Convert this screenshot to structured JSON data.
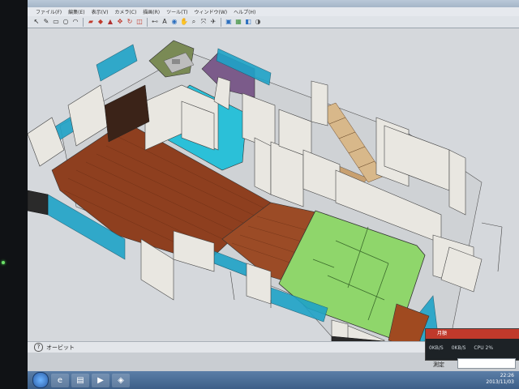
{
  "menu": {
    "items": [
      "ファイル(F)",
      "編集(E)",
      "表示(V)",
      "カメラ(C)",
      "描画(R)",
      "ツール(T)",
      "ウィンドウ(W)",
      "ヘルプ(H)"
    ]
  },
  "toolbar": {
    "tools": [
      {
        "icon": "select-arrow-icon",
        "glyph": "↖",
        "color": "#222"
      },
      {
        "icon": "line-pencil-icon",
        "glyph": "✎",
        "color": "#333"
      },
      {
        "icon": "rectangle-icon",
        "glyph": "▭",
        "color": "#333"
      },
      {
        "icon": "circle-icon",
        "glyph": "○",
        "color": "#333"
      },
      {
        "icon": "arc-icon",
        "glyph": "◠",
        "color": "#333"
      },
      {
        "icon": "eraser-icon",
        "glyph": "▰",
        "color": "#c0392b"
      },
      {
        "icon": "paint-bucket-icon",
        "glyph": "◆",
        "color": "#c0392b"
      },
      {
        "icon": "push-pull-icon",
        "glyph": "▲",
        "color": "#b03030"
      },
      {
        "icon": "move-icon",
        "glyph": "✥",
        "color": "#c0392b"
      },
      {
        "icon": "rotate-icon",
        "glyph": "↻",
        "color": "#c0392b"
      },
      {
        "icon": "offset-icon",
        "glyph": "◫",
        "color": "#c0392b"
      },
      {
        "icon": "tape-measure-icon",
        "glyph": "⊷",
        "color": "#555"
      },
      {
        "icon": "text-icon",
        "glyph": "A",
        "color": "#333"
      },
      {
        "icon": "orbit-icon",
        "glyph": "◉",
        "color": "#2c6fbf"
      },
      {
        "icon": "pan-icon",
        "glyph": "✋",
        "color": "#555"
      },
      {
        "icon": "zoom-icon",
        "glyph": "⌕",
        "color": "#333"
      },
      {
        "icon": "zoom-extents-icon",
        "glyph": "⤧",
        "color": "#333"
      },
      {
        "icon": "walk-icon",
        "glyph": "✈",
        "color": "#333"
      },
      {
        "icon": "component-icon",
        "glyph": "▣",
        "color": "#2c6fbf"
      },
      {
        "icon": "group-icon",
        "glyph": "▦",
        "color": "#3a8f3a"
      },
      {
        "icon": "section-icon",
        "glyph": "◧",
        "color": "#2c6fbf"
      },
      {
        "icon": "shadow-icon",
        "glyph": "◑",
        "color": "#555"
      }
    ]
  },
  "status": {
    "hint": "オービット"
  },
  "measure": {
    "label": "測定"
  },
  "netwidget": {
    "title": "月額",
    "down": "0KB/S",
    "up": "0KB/S",
    "cpu": "CPU 2%"
  },
  "clock": {
    "time": "22:26",
    "date": "2013/11/03"
  },
  "colors": {
    "accent": "#2c6fbf",
    "wall": "#e9e7e1",
    "glass": "#1fa3c7",
    "tatami": "#8fd66b",
    "wood": "#9b4b26"
  }
}
